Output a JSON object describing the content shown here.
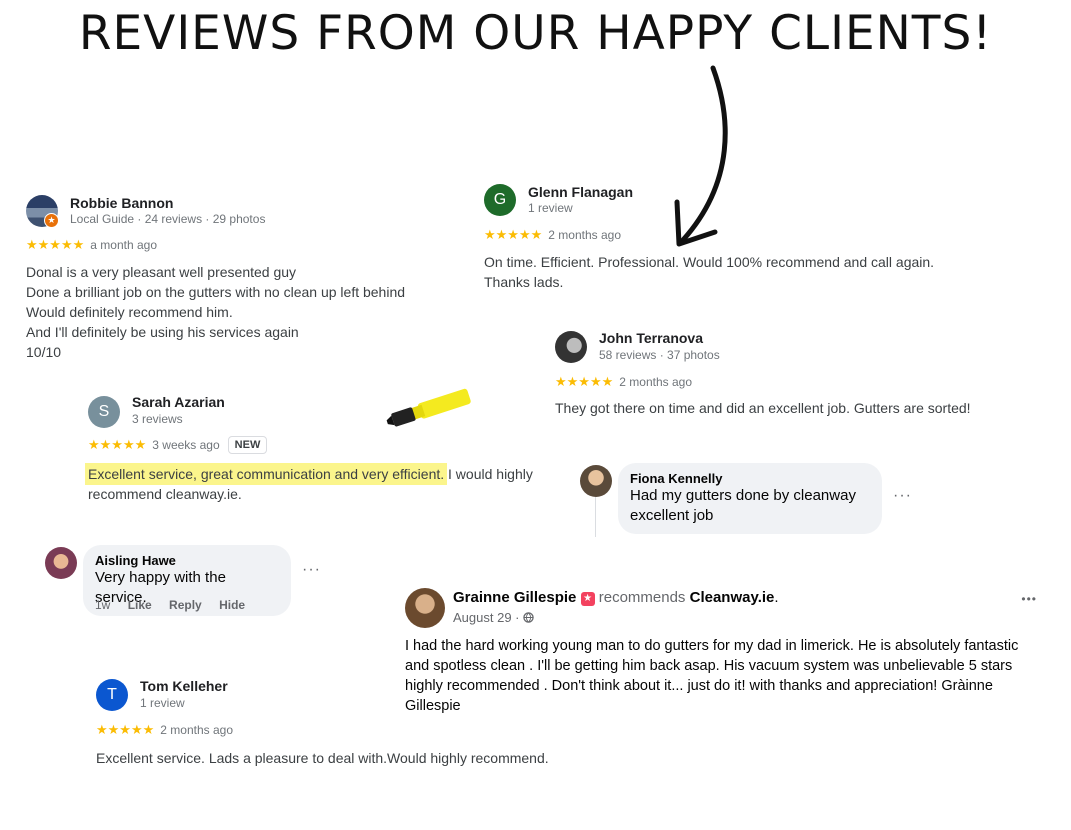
{
  "headline": "REVIEWS FROM OUR HAPPY CLIENTS!",
  "colors": {
    "star": "#fbbc04",
    "highlight": "#fbf58c",
    "glenn_avatar": "#1e6b2a",
    "sarah_avatar": "#78909c",
    "tom_avatar": "#0b57d0",
    "recommend_icon": "#f3425f"
  },
  "icons": [
    "curved-arrow-icon",
    "highlighter-pen-icon",
    "star-icon",
    "globe-icon",
    "more-options-icon",
    "recommend-badge-icon"
  ],
  "reviews": {
    "robbie": {
      "name": "Robbie Bannon",
      "meta": "Local Guide · 24 reviews · 29 photos",
      "stars": "★★★★★",
      "when": "a month ago",
      "lines": [
        "Donal is a very pleasant well presented guy",
        "Done a brilliant job on the gutters with no clean up left behind",
        "Would definitely recommend him.",
        "And I'll definitely be using his services again",
        "10/10"
      ]
    },
    "glenn": {
      "initial": "G",
      "name": "Glenn Flanagan",
      "meta": "1 review",
      "stars": "★★★★★",
      "when": "2 months ago",
      "lines": [
        "On time. Efficient. Professional. Would 100% recommend and call again.",
        "Thanks lads."
      ]
    },
    "john": {
      "name": "John Terranova",
      "meta": "58 reviews · 37 photos",
      "stars": "★★★★★",
      "when": "2 months ago",
      "text": "They got there on time and did an excellent job. Gutters are sorted!"
    },
    "sarah": {
      "initial": "S",
      "name": "Sarah Azarian",
      "meta": "3 reviews",
      "stars": "★★★★★",
      "when": "3 weeks ago",
      "badge": "NEW",
      "highlighted": "Excellent service, great communication and very efficient.",
      "rest": " I would highly",
      "line2": "recommend cleanway.ie."
    },
    "tom": {
      "initial": "T",
      "name": "Tom Kelleher",
      "meta": "1 review",
      "stars": "★★★★★",
      "when": "2 months ago",
      "text": "Excellent service. Lads a pleasure to deal with.Would highly recommend."
    }
  },
  "comments": {
    "fiona": {
      "name": "Fiona Kennelly",
      "lines": [
        "Had my gutters done by cleanway",
        "excellent job"
      ],
      "more": "···"
    },
    "aisling": {
      "name": "Aisling Hawe",
      "text": "Very happy with the service.",
      "more": "···",
      "time": "1w",
      "like": "Like",
      "reply": "Reply",
      "hide": "Hide"
    }
  },
  "facebook_post": {
    "name": "Grainne Gillespie",
    "recommends": "recommends",
    "page": "Cleanway.ie",
    "period": ".",
    "date": "August 29",
    "dot": "·",
    "more": "•••",
    "lines": [
      "I had the hard working young man to do gutters for my dad in limerick. He is absolutely fantastic",
      "and spotless clean . I'll be getting him back asap. His vacuum system was unbelievable 5 stars",
      "highly recommended . Don't think about it... just do it! with thanks and appreciation! Gràinne",
      "Gillespie"
    ]
  }
}
